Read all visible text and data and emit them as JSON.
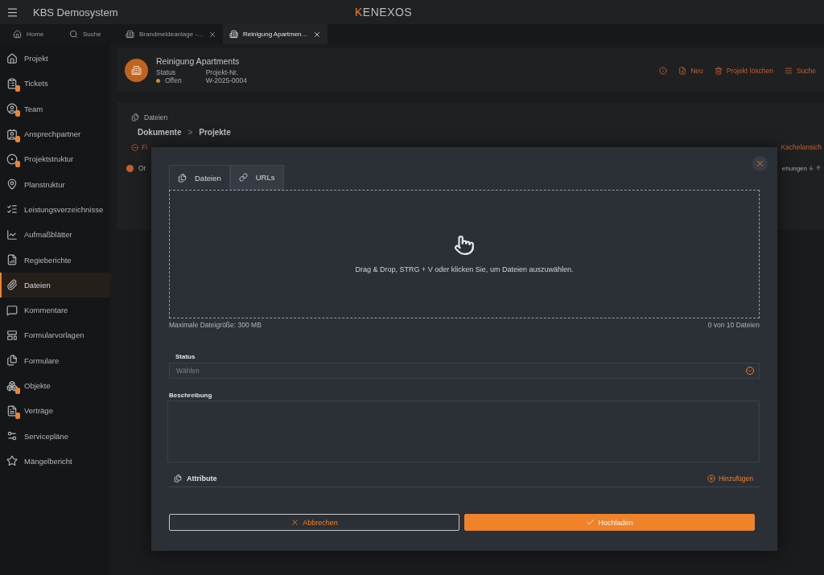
{
  "app": {
    "title": "KBS Demosystem",
    "logo": "KENEXOS"
  },
  "nav_tabs": [
    {
      "label": "Home",
      "selected": false,
      "closable": false
    },
    {
      "label": "Suche",
      "selected": false,
      "closable": false
    },
    {
      "label": "Brandmeldeanlage -…",
      "selected": false,
      "closable": true
    },
    {
      "label": "Reinigung Apartmen…",
      "selected": true,
      "closable": true
    }
  ],
  "sidebar": {
    "items": [
      {
        "label": "Projekt",
        "badge": false,
        "selected": false
      },
      {
        "label": "Tickets",
        "badge": true,
        "selected": false
      },
      {
        "label": "Team",
        "badge": true,
        "selected": false
      },
      {
        "label": "Ansprechpartner",
        "badge": true,
        "selected": false
      },
      {
        "label": "Projektstruktur",
        "badge": true,
        "selected": false
      },
      {
        "label": "Planstruktur",
        "badge": false,
        "selected": false
      },
      {
        "label": "Leistungsverzeichnisse",
        "badge": false,
        "selected": false
      },
      {
        "label": "Aufmaßblätter",
        "badge": false,
        "selected": false
      },
      {
        "label": "Regieberichte",
        "badge": false,
        "selected": false
      },
      {
        "label": "Dateien",
        "badge": false,
        "selected": true
      },
      {
        "label": "Kommentare",
        "badge": false,
        "selected": false
      },
      {
        "label": "Formularvorlagen",
        "badge": false,
        "selected": false
      },
      {
        "label": "Formulare",
        "badge": false,
        "selected": false
      },
      {
        "label": "Objekte",
        "badge": true,
        "selected": false
      },
      {
        "label": "Verträge",
        "badge": true,
        "selected": false
      },
      {
        "label": "Servicepläne",
        "badge": false,
        "selected": false
      },
      {
        "label": "Mängelbericht",
        "badge": false,
        "selected": false
      }
    ]
  },
  "project": {
    "title": "Reinigung Apartments",
    "status_label": "Status",
    "status": "Offen",
    "number_label": "Projekt-Nr.",
    "number": "W-2025-0004",
    "actions": [
      "Neu",
      "Projekt löschen",
      "Suche"
    ]
  },
  "files_panel": {
    "title": "Dateien",
    "breadcrumb": [
      "Dokumente",
      "Projekte"
    ],
    "breadcrumb_separator": ">",
    "filter": "Fi",
    "order": "Or",
    "view": "Kachelansich",
    "sort": "ehungen"
  },
  "dialog": {
    "tabs": [
      {
        "label": "Dateien",
        "selected": true
      },
      {
        "label": "URLs",
        "selected": false
      }
    ],
    "dropzone_text": "Drag & Drop, STRG + V oder klicken Sie, um Dateien auszuwählen.",
    "max_size": "Maximale Dateigröße: 300 MB",
    "count": "0 von 10 Dateien",
    "status": {
      "label": "Status",
      "placeholder": "Wählen"
    },
    "description": {
      "label": "Beschreibung"
    },
    "attributes": {
      "label": "Attribute",
      "add": "Hinzufügen"
    },
    "cancel": "Abbrechen",
    "submit": "Hochladen"
  }
}
